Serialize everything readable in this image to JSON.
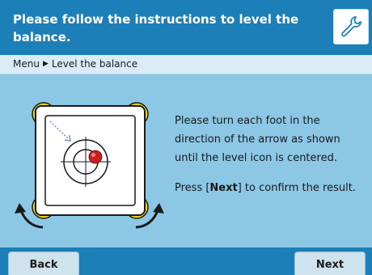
{
  "header": {
    "title": "Please follow the instructions to level the balance.",
    "tool_icon": "wrench-icon"
  },
  "breadcrumb": {
    "items": [
      "Menu",
      "Level the balance"
    ],
    "separator_icon": "triangle-right-icon"
  },
  "instructions": {
    "line1": "Please turn each foot in the direction of the arrow as shown until the level icon is centered.",
    "line2_prefix": "Press [",
    "line2_key": "Next",
    "line2_suffix": "] to confirm the result."
  },
  "footer": {
    "back_label": "Back",
    "next_label": "Next"
  },
  "colors": {
    "header_bg": "#1c7fb8",
    "content_bg": "#8cc8e6",
    "breadcrumb_bg": "#dcecf6",
    "button_bg": "#cfe3ef",
    "foot_yellow": "#f2d21a",
    "bubble_red": "#cc1f1f"
  }
}
